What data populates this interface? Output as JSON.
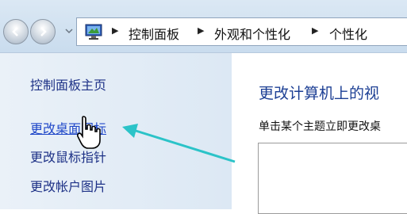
{
  "breadcrumb": {
    "items": [
      "控制面板",
      "外观和个性化",
      "个性化"
    ],
    "separator": "▶",
    "icon": "control-panel-icon"
  },
  "nav": {
    "back_icon": "back-arrow-icon",
    "forward_icon": "forward-arrow-icon",
    "dropdown_icon": "chevron-down-icon"
  },
  "sidebar": {
    "home": "控制面板主页",
    "links": [
      "更改桌面图标",
      "更改鼠标指针",
      "更改帐户图片"
    ]
  },
  "main": {
    "title": "更改计算机上的视",
    "description": "单击某个主题立即更改桌"
  },
  "colors": {
    "link": "#1e3287",
    "title": "#1c3f94",
    "arrow": "#2bc3c8"
  },
  "annotation": {
    "cursor_icon": "hand-pointer-icon",
    "arrow_icon": "teal-arrow-icon"
  }
}
